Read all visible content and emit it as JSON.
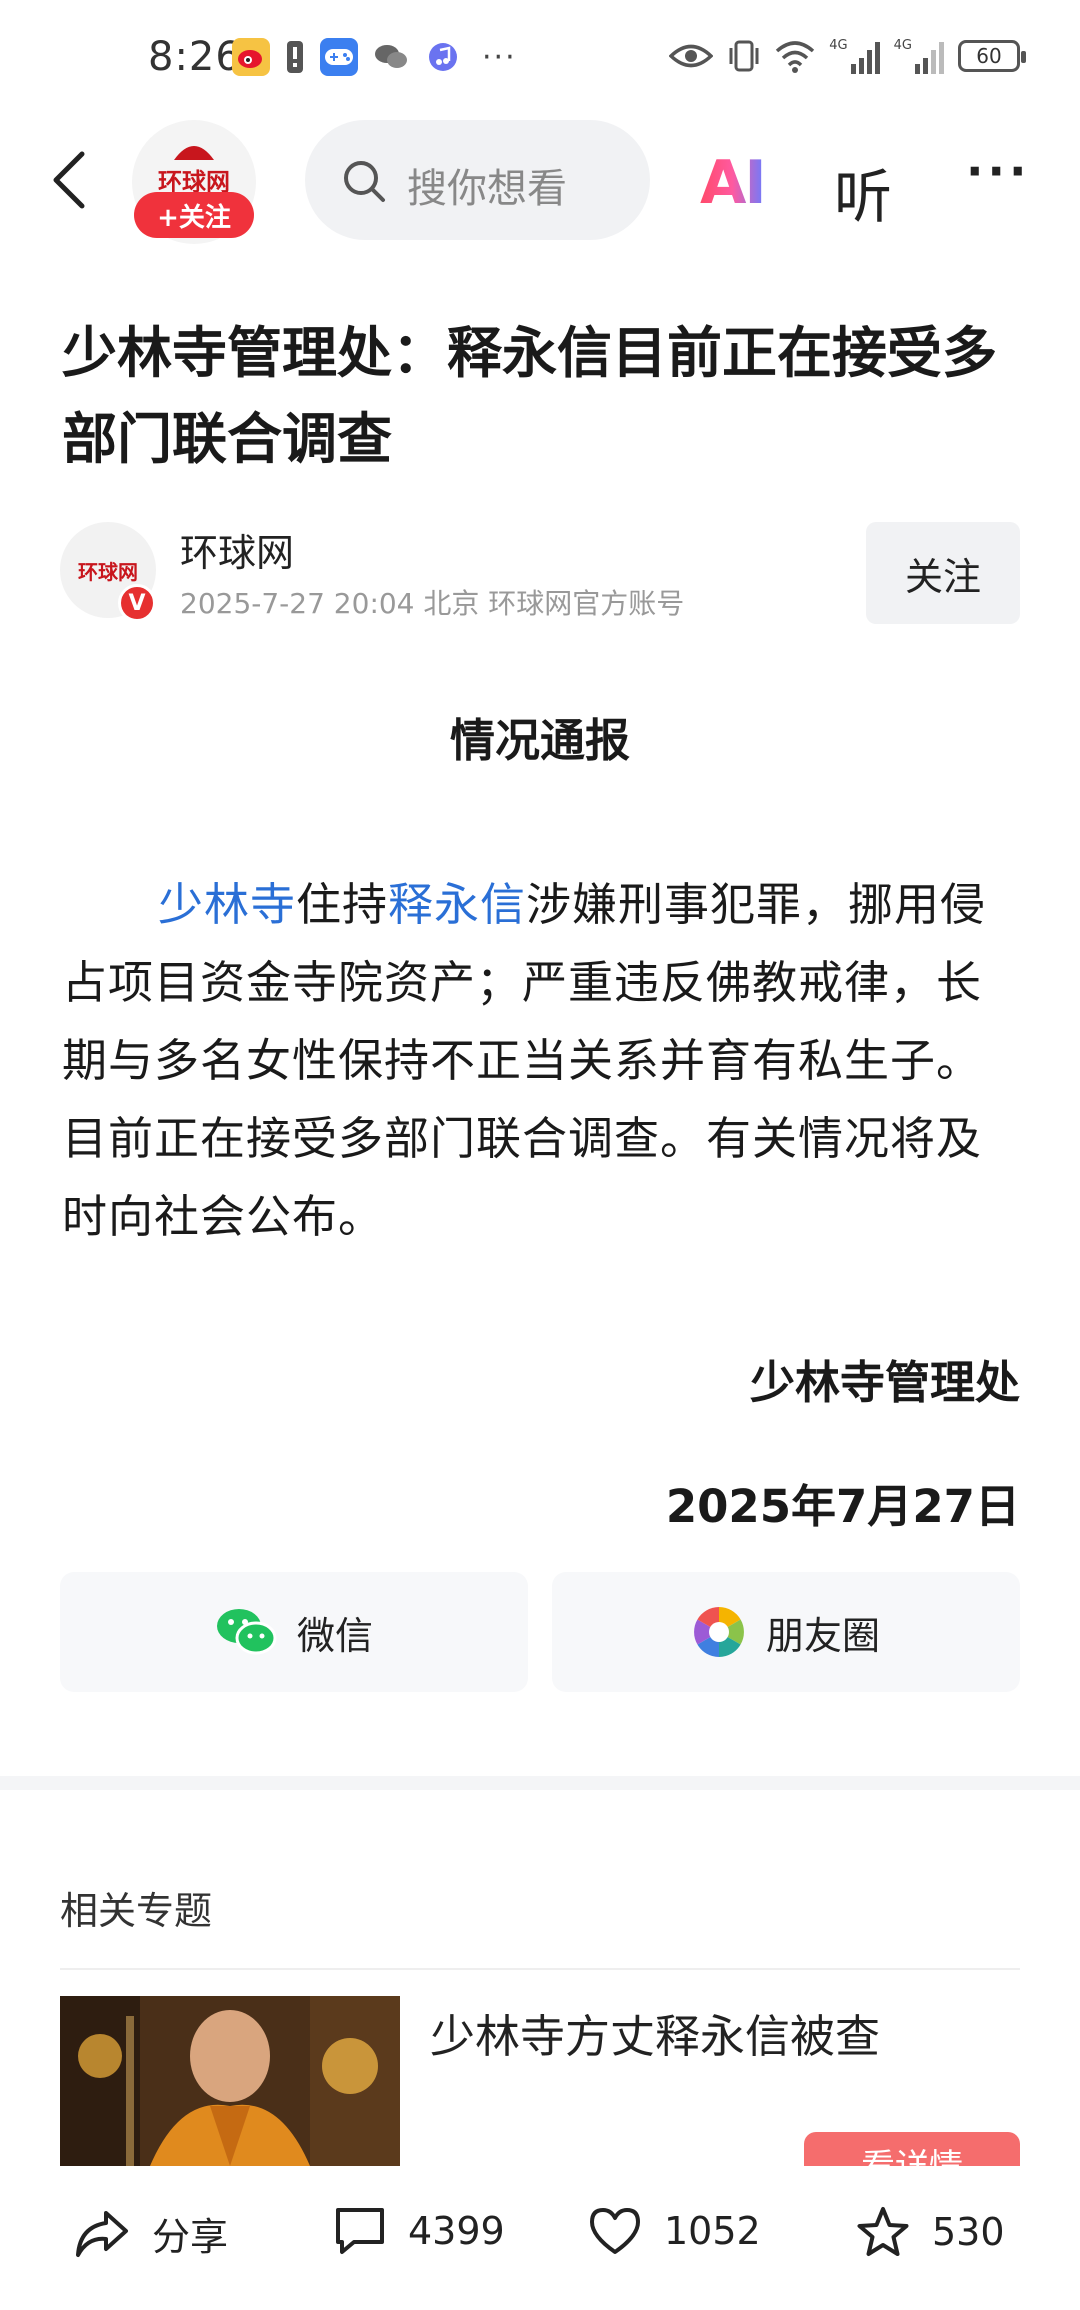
{
  "status_bar": {
    "time": "8:26",
    "battery": "60",
    "network_a": "4G",
    "network_b": "4G"
  },
  "nav": {
    "media_logo_text": "环球网",
    "follow_pill": "+关注",
    "search_placeholder": "搜你想看",
    "ai_label": "AI",
    "listen_label": "听",
    "more_label": "···"
  },
  "article": {
    "title": "少林寺管理处：释永信目前正在接受多部门联合调查",
    "author": {
      "avatar_text": "环球网",
      "badge": "V",
      "name": "环球网",
      "meta": "2025-7-27  20:04  北京  环球网官方账号",
      "follow_label": "关注"
    },
    "notice_title": "情况通报",
    "body": {
      "link_1": "少林寺",
      "text_1": "住持",
      "link_2": "释永信",
      "text_2": "涉嫌刑事犯罪，挪用侵占项目资金寺院资产；严重违反佛教戒律，长期与多名女性保持不正当关系并育有私生子。目前正在接受多部门联合调查。有关情况将及时向社会公布。"
    },
    "signature_org": "少林寺管理处",
    "signature_date": "2025年7月27日"
  },
  "share": {
    "wechat_label": "微信",
    "moments_label": "朋友圈"
  },
  "related": {
    "section_title": "相关专题",
    "item_title": "少林寺方丈释永信被查",
    "detail_button": "看详情"
  },
  "bottom_bar": {
    "share_label": "分享",
    "comment_count": "4399",
    "like_count": "1052",
    "favorite_count": "530"
  },
  "colors": {
    "accent_red": "#f0323c",
    "link_blue": "#2a6fd6",
    "ai_gradient_start": "#ff4a6a",
    "ai_gradient_end": "#6a7cff"
  }
}
